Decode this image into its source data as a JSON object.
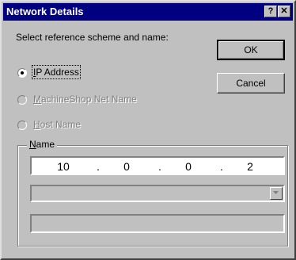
{
  "window": {
    "title": "Network Details",
    "help_label": "?",
    "close_label": "✕"
  },
  "prompt": "Select reference scheme and name:",
  "options": [
    {
      "pre": "",
      "accel": "I",
      "rest": "P Address",
      "selected": true,
      "enabled": true
    },
    {
      "pre": "",
      "accel": "M",
      "rest": "achineShop Net Name",
      "selected": false,
      "enabled": false
    },
    {
      "pre": "",
      "accel": "H",
      "rest": "ost Name",
      "selected": false,
      "enabled": false
    }
  ],
  "buttons": {
    "ok": "OK",
    "cancel": "Cancel"
  },
  "name_group": {
    "accel": "N",
    "rest": "ame"
  },
  "ip": {
    "o1": "10",
    "o2": "0",
    "o3": "0",
    "o4": "2",
    "sep": "."
  },
  "combo": {
    "value": ""
  },
  "bottom_field": {
    "value": ""
  }
}
